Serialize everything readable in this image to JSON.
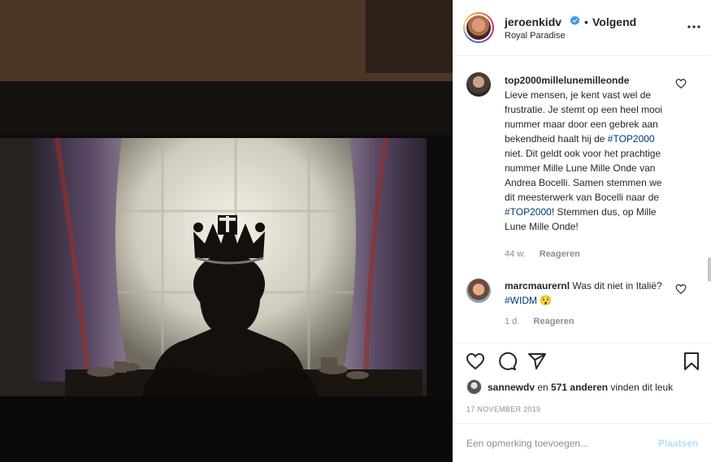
{
  "post": {
    "image_alt": "Silhouet van een koningin met kroon voor een raam",
    "author": {
      "username": "jeroenkidv",
      "verified": true,
      "follow_separator": "•",
      "follow_label": "Volgend",
      "location": "Royal Paradise"
    },
    "comments": [
      {
        "username": "top2000millelunemilleonde",
        "text_parts": [
          "Lieve mensen, je kent vast wel de frustratie. Je stemt op een heel mooi nummer maar door een gebrek aan bekendheid haalt hij de ",
          "#TOP2000",
          " niet. Dit geldt ook voor het prachtige nummer Mille Lune Mille Onde van Andrea Bocelli. Samen stemmen we dit meesterwerk van Bocelli naar de ",
          "#TOP2000",
          "! Stemmen dus, op Mille Lune Mille Onde!"
        ],
        "age": "44 w.",
        "reply_label": "Reageren"
      },
      {
        "username": "marcmaurernl",
        "text_parts": [
          "Was dit niet in Italië? ",
          "#WIDM",
          " 😯"
        ],
        "age": "1 d.",
        "reply_label": "Reageren"
      }
    ],
    "likes": {
      "first_user": "sannewdv",
      "connector": " en ",
      "others": "571 anderen",
      "suffix": " vinden dit leuk"
    },
    "date": "17 NOVEMBER 2019",
    "add_comment": {
      "placeholder": "Een opmerking toevoegen...",
      "post_label": "Plaatsen"
    },
    "icons": [
      "heart-icon",
      "comment-icon",
      "share-icon",
      "bookmark-icon",
      "more-options-icon",
      "verified-badge-icon"
    ],
    "colors": {
      "link": "#00376b",
      "verified": "#3897f0",
      "muted": "#8e8e8e",
      "post_disabled": "#b2dffc"
    }
  }
}
